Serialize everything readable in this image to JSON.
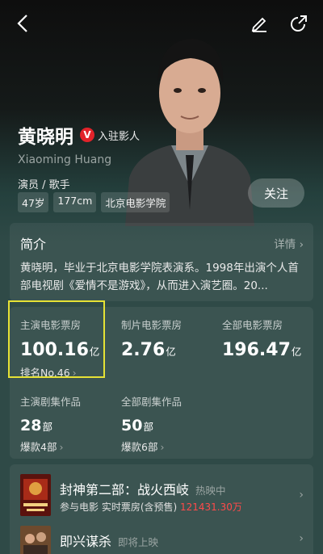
{
  "header": {
    "back_icon": "back-arrow-icon",
    "edit_icon": "pencil-icon",
    "share_icon": "share-icon"
  },
  "profile": {
    "name": "黄晓明",
    "badge_letter": "V",
    "badge_label": "入驻影人",
    "pinyin": "Xiaoming Huang",
    "roles": "演员 / 歌手",
    "tags": [
      "47岁",
      "177cm",
      "北京电影学院"
    ],
    "follow_label": "关注"
  },
  "intro": {
    "title": "简介",
    "detail_label": "详情",
    "text": "黄晓明，毕业于北京电影学院表演系。1998年出演个人首部电视剧《爱情不是游戏》，从而进入演艺圈。20..."
  },
  "stats": {
    "lead_box_office": {
      "label": "主演电影票房",
      "value": "100.16",
      "unit": "亿",
      "sub": "排名No.46"
    },
    "producer_box_office": {
      "label": "制片电影票房",
      "value": "2.76",
      "unit": "亿"
    },
    "total_box_office": {
      "label": "全部电影票房",
      "value": "196.47",
      "unit": "亿"
    },
    "lead_series": {
      "label": "主演剧集作品",
      "value": "28",
      "unit": "部",
      "sub": "爆款4部"
    },
    "all_series": {
      "label": "全部剧集作品",
      "value": "50",
      "unit": "部",
      "sub": "爆款6部"
    }
  },
  "works": [
    {
      "title": "封神第二部：战火西岐",
      "status": "热映中",
      "meta_prefix": "参与电影  实时票房(含预售) ",
      "meta_value": "121431.30万"
    },
    {
      "title": "即兴谋杀",
      "status": "即将上映"
    }
  ],
  "colors": {
    "accent_red": "#e2232a",
    "highlight": "#e6e235",
    "background": "#2f4a47"
  }
}
